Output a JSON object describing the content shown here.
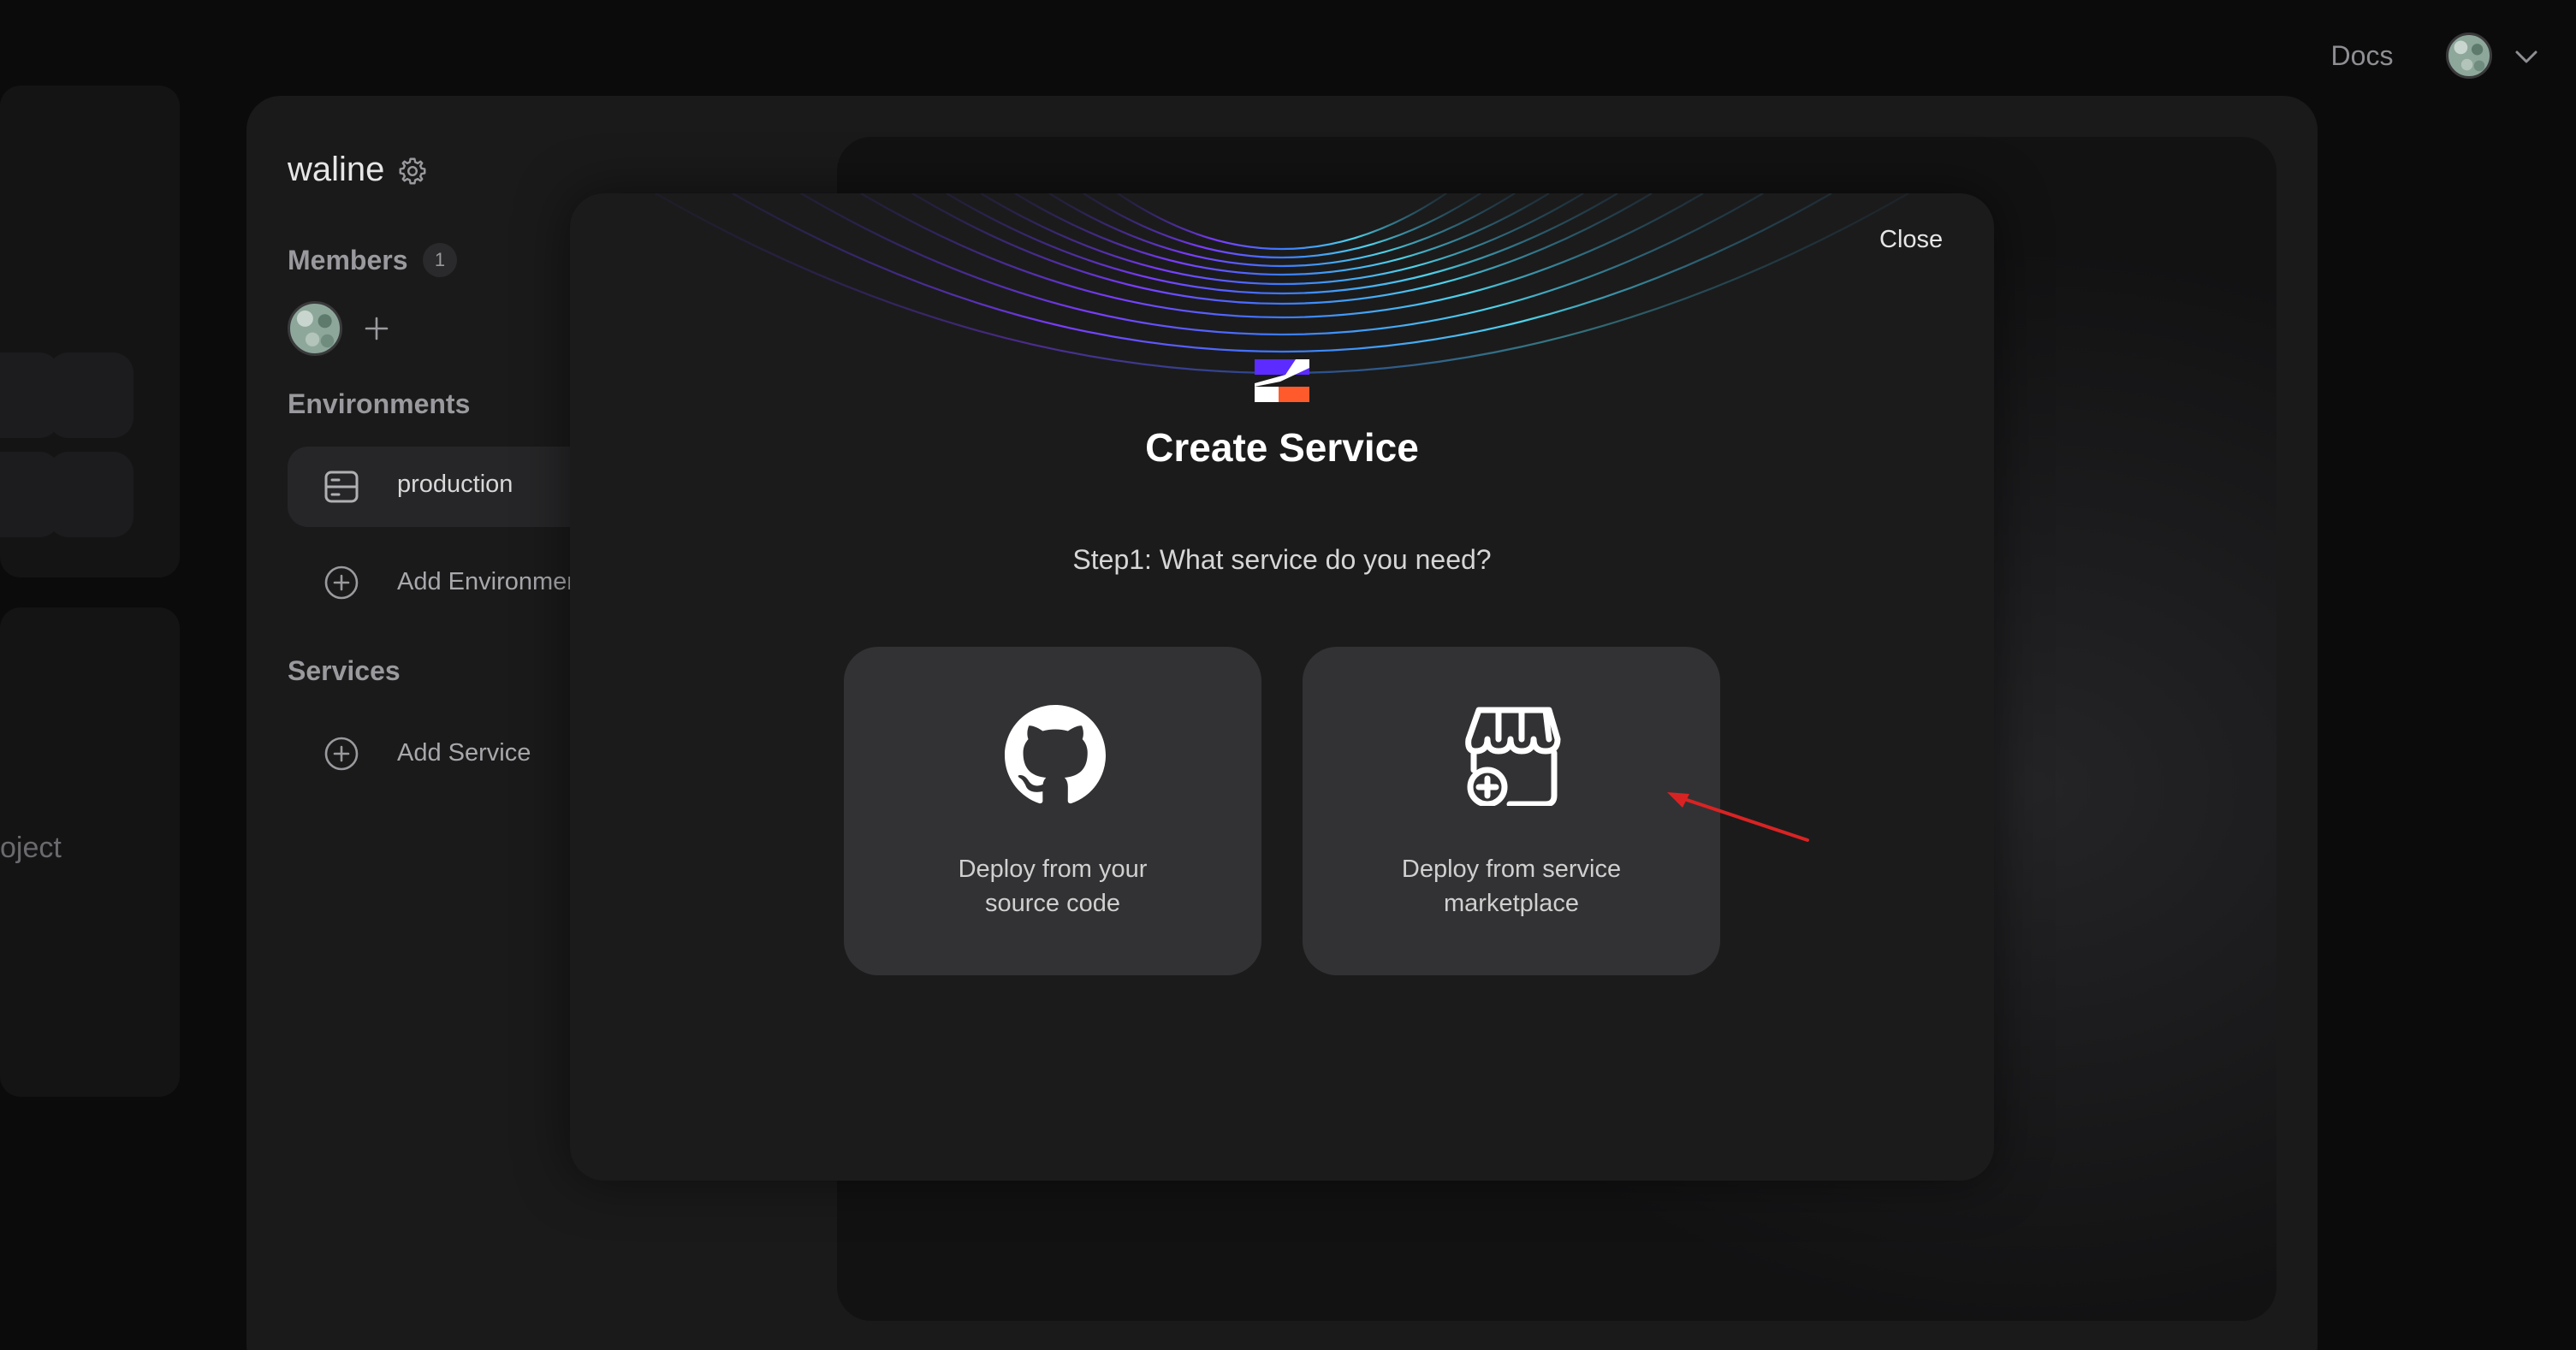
{
  "topbar": {
    "docs_label": "Docs"
  },
  "ghost": {
    "partial_text": "oject"
  },
  "project": {
    "name": "waline"
  },
  "members": {
    "label": "Members",
    "count": "1"
  },
  "environments": {
    "label": "Environments",
    "items": [
      {
        "label": "production"
      }
    ],
    "add_label": "Add Environment"
  },
  "services": {
    "label": "Services",
    "add_label": "Add Service"
  },
  "modal": {
    "close_label": "Close",
    "title": "Create Service",
    "subtitle": "Step1: What service do you need?",
    "options": [
      {
        "label": "Deploy from your\nsource code",
        "icon": "github-icon"
      },
      {
        "label": "Deploy from service\nmarketplace",
        "icon": "marketplace-icon"
      }
    ]
  },
  "colors": {
    "accent_purple": "#5b2bff",
    "accent_orange": "#ff5a2c",
    "annotation_arrow": "#d92323"
  }
}
